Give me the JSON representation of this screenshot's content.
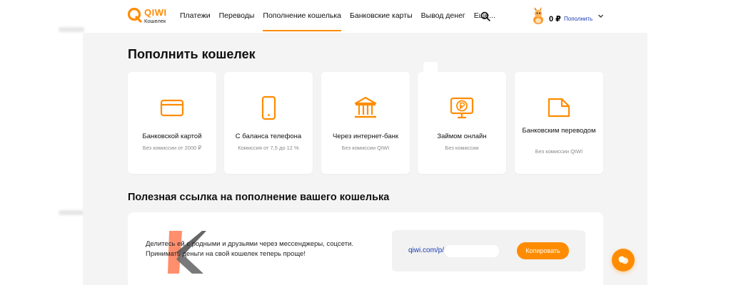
{
  "header": {
    "logo": {
      "word": "QIWI",
      "sub": "Кошелек"
    },
    "nav": [
      {
        "label": "Платежи",
        "active": false
      },
      {
        "label": "Переводы",
        "active": false
      },
      {
        "label": "Пополнение кошелька",
        "active": true
      },
      {
        "label": "Банковские карты",
        "active": false
      },
      {
        "label": "Вывод денег",
        "active": false
      },
      {
        "label": "Еще...",
        "active": false
      }
    ],
    "balance": "0 ₽",
    "topup_label": "Пополнить"
  },
  "main": {
    "title": "Пополнить кошелек",
    "methods": [
      {
        "label": "Банковской картой",
        "sub": "Без комиссии от 2000 ₽",
        "icon": "credit-card-icon"
      },
      {
        "label": "С баланса телефона",
        "sub": "Комиссия от 7,5 до 12 %",
        "icon": "smartphone-icon"
      },
      {
        "label": "Через интернет-банк",
        "sub": "Без комиссии QIWI",
        "icon": "bank-icon"
      },
      {
        "label": "Займом онлайн",
        "sub": "Без комиссии",
        "icon": "monitor-ruble-icon"
      },
      {
        "label": "Банковским переводом",
        "sub": "Без комиссии QIWI",
        "icon": "document-icon"
      }
    ],
    "share": {
      "title": "Полезная ссылка на пополнение вашего кошелька",
      "text_line1": "Делитесь ей с родными и друзьями через мессенджеры, соцсети.",
      "text_line2": "Принимать деньги на свой кошелек теперь проще!",
      "link_text": "qiwi.com/p/",
      "copy_label": "Копировать"
    }
  },
  "colors": {
    "accent": "#ff8c00",
    "link": "#1a3cb3",
    "panel": "#f4f4f4"
  }
}
